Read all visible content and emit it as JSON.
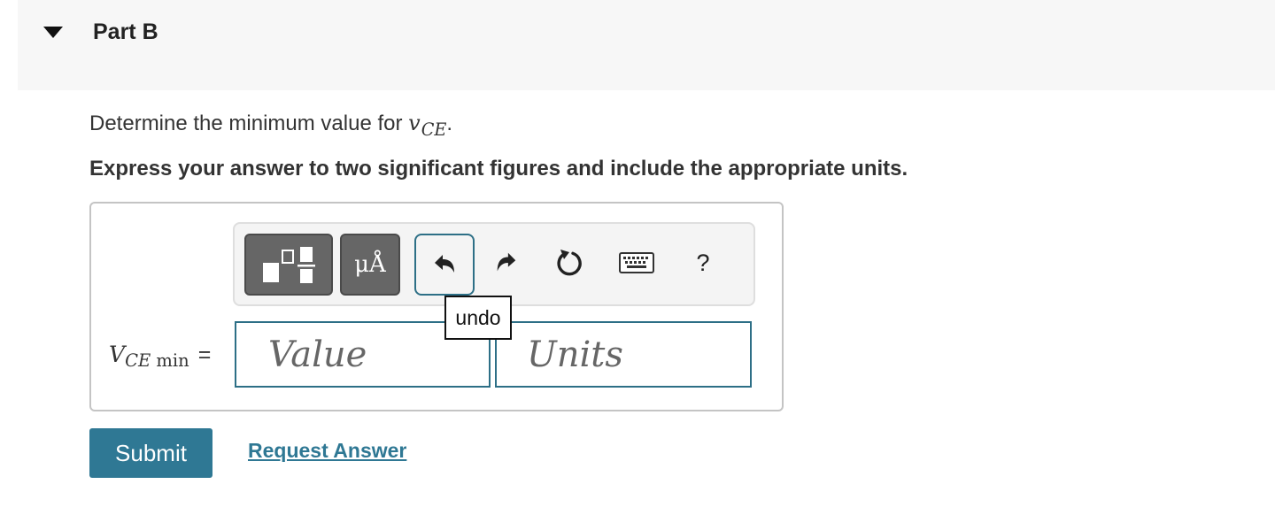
{
  "part": {
    "title": "Part B"
  },
  "question": {
    "prefix": "Determine the minimum value for ",
    "var_main": "v",
    "var_sub": "CE",
    "suffix": "."
  },
  "instruction": "Express your answer to two significant figures and include the appropriate units.",
  "toolbar": {
    "units_label": "μÅ",
    "help_label": "?",
    "tooltip": "undo",
    "icons": [
      "templates-icon",
      "units-icon",
      "undo-icon",
      "redo-icon",
      "reset-icon",
      "keyboard-icon",
      "help-icon"
    ]
  },
  "answer": {
    "label_main": "V",
    "label_sub": "CE",
    "label_sub2": "min",
    "equals": "=",
    "value_placeholder": "Value",
    "units_placeholder": "Units"
  },
  "actions": {
    "submit_label": "Submit",
    "request_label": "Request Answer"
  },
  "colors": {
    "accent": "#2f7894",
    "input_border": "#2d6f86",
    "header_bg": "#f7f7f7"
  }
}
